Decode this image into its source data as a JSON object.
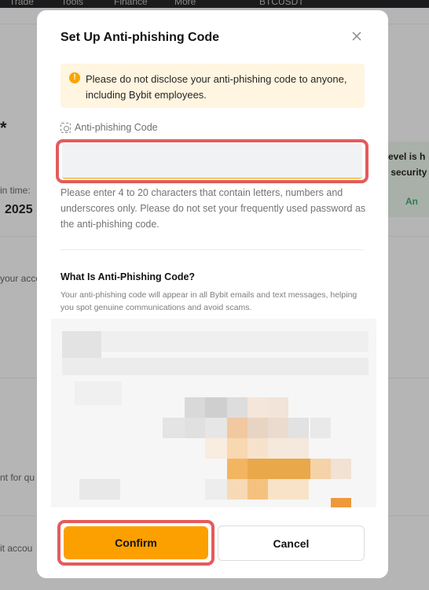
{
  "background": {
    "nav": [
      "Trade",
      "Tools",
      "Finance",
      "More",
      "BTCUSDT"
    ],
    "fragments": {
      "left_star": "*",
      "login_time_label": "in time:",
      "year": "2025",
      "your_account": "your acco",
      "for_quick": "nt for qu",
      "bybit_account": "it accou",
      "level_is": "evel is h",
      "of_security": "f security",
      "right_check": "An"
    }
  },
  "modal": {
    "title": "Set Up Anti-phishing Code",
    "close_icon": "close-icon",
    "warning": {
      "icon": "info-icon",
      "text": "Please do not disclose your anti-phishing code to anyone, including Bybit employees."
    },
    "field": {
      "icon": "scan-code-icon",
      "label": "Anti-phishing Code",
      "value": "",
      "placeholder": ""
    },
    "hint": "Please enter 4 to 20 characters that contain letters, numbers and underscores only. Please do not set your frequently used password as the anti-phishing code.",
    "info": {
      "title": "What Is Anti-Phishing Code?",
      "description": "Your anti-phishing code will appear in all Bybit emails and text messages, helping you spot genuine communications and avoid scams."
    },
    "buttons": {
      "confirm": "Confirm",
      "cancel": "Cancel"
    }
  },
  "colors": {
    "accent": "#fca000",
    "highlight": "#e45b5b",
    "warning_bg": "#fff5e0"
  }
}
